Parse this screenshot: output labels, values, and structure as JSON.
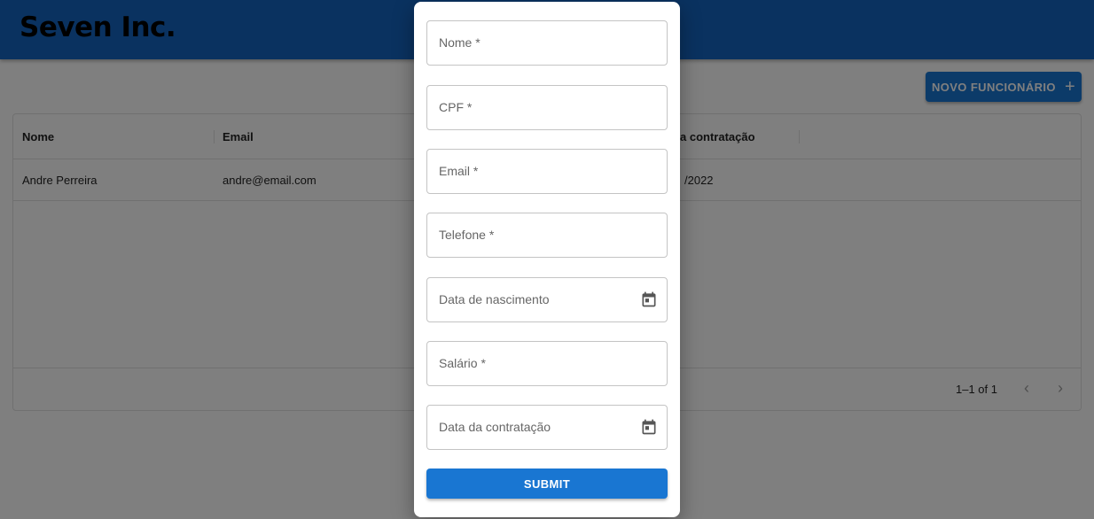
{
  "app": {
    "title": "Seven Inc."
  },
  "toolbar": {
    "new_button_label": "NOVO FUNCIONÁRIO",
    "new_button_icon": "plus-icon"
  },
  "grid": {
    "columns": [
      "Nome",
      "Email",
      "a contratação"
    ],
    "rows": [
      {
        "nome": "Andre Perreira",
        "email": "andre@email.com",
        "contratacao": "/2022"
      }
    ],
    "pagination": {
      "label": "1–1 of 1"
    }
  },
  "form": {
    "fields": [
      {
        "placeholder": "Nome *"
      },
      {
        "placeholder": "CPF *"
      },
      {
        "placeholder": "Email *"
      },
      {
        "placeholder": "Telefone *"
      },
      {
        "placeholder": "Data de nascimento",
        "icon": "calendar-icon"
      },
      {
        "placeholder": "Salário *"
      },
      {
        "placeholder": "Data da contratação",
        "icon": "calendar-icon"
      }
    ],
    "submit_label": "SUBMIT"
  },
  "colors": {
    "primary": "#1976d2",
    "appbar": "#1565c0"
  }
}
